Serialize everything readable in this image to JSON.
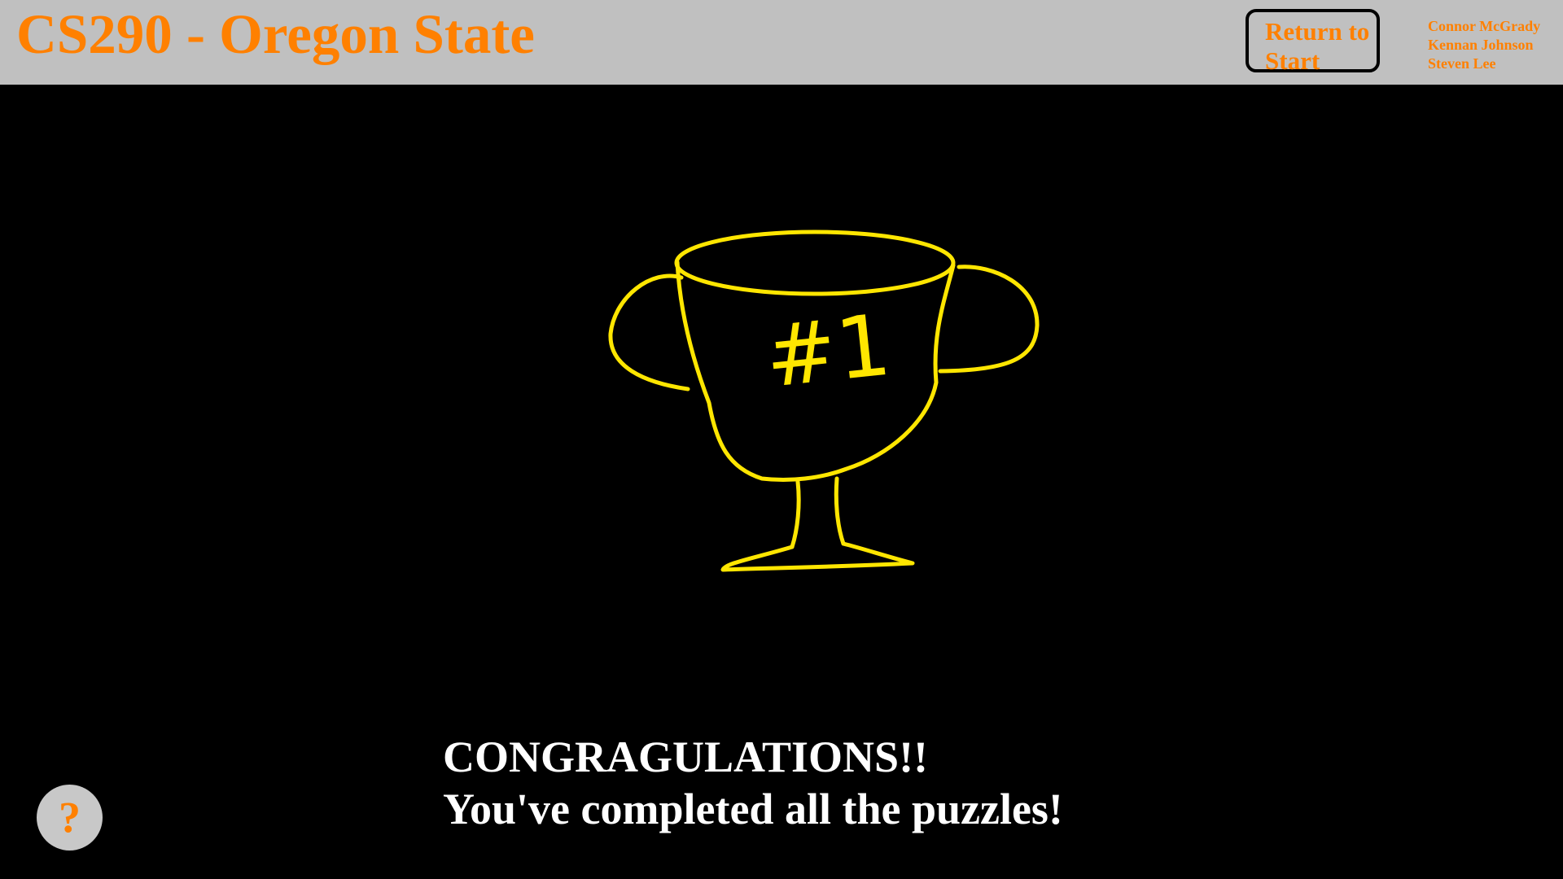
{
  "header": {
    "title": "CS290 - Oregon State",
    "return_button": {
      "line1": "Return to",
      "line2": "Start"
    },
    "authors": [
      "Connor McGrady",
      "Kennan Johnson",
      "Steven Lee"
    ]
  },
  "main": {
    "trophy_label": "#1",
    "message": {
      "line1": "CONGRAGULATIONS!!",
      "line2": "You've completed all the puzzles!"
    }
  },
  "help_button": {
    "label": "?"
  },
  "colors": {
    "accent": "#ff8000",
    "header_bg": "#c0c0c0",
    "page_bg": "#000000",
    "trophy": "#ffe600",
    "message_text": "#ffffff",
    "help_bg": "#c8c8c8"
  },
  "icons": {
    "trophy": "trophy-icon"
  }
}
